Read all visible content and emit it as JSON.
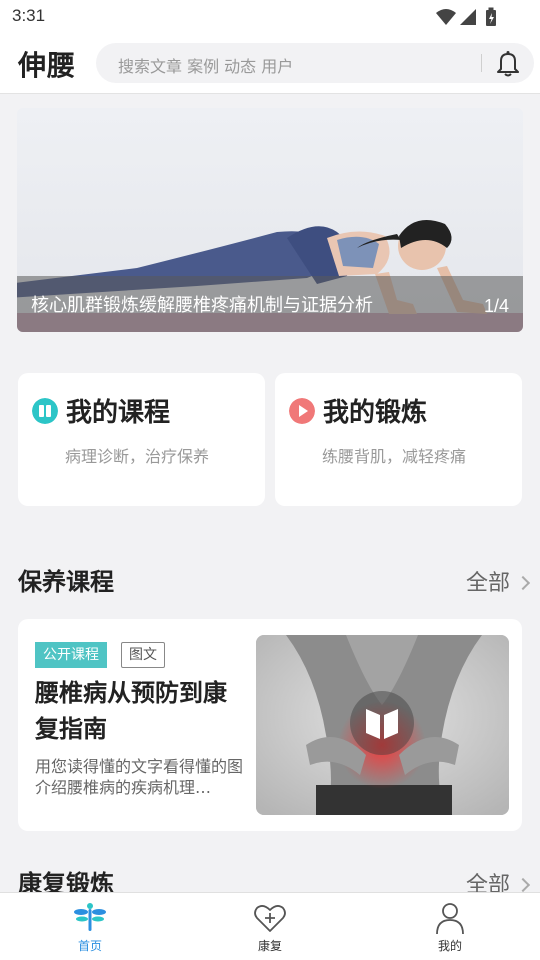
{
  "status_bar": {
    "time": "3:31"
  },
  "header": {
    "app_title": "伸腰",
    "search_placeholder": "搜索文章 案例 动态 用户"
  },
  "banner": {
    "caption": "核心肌群锻炼缓解腰椎疼痛机制与证据分析",
    "counter": "1/4"
  },
  "quick_cards": [
    {
      "title": "我的课程",
      "subtitle": "病理诊断，治疗保养",
      "icon": "book-icon",
      "color": "#2cc5c7"
    },
    {
      "title": "我的锻炼",
      "subtitle": "练腰背肌，减轻疼痛",
      "icon": "play-icon",
      "color": "#f07878"
    }
  ],
  "sections": {
    "care": {
      "title": "保养课程",
      "more": "全部"
    },
    "rehab": {
      "title": "康复锻炼",
      "more": "全部"
    }
  },
  "course": {
    "tag_public": "公开课程",
    "tag_type": "图文",
    "title": "腰椎病从预防到康复指南",
    "description": "用您读得懂的文字看得懂的图介绍腰椎病的疾病机理…"
  },
  "bottom_nav": [
    {
      "label": "首页",
      "icon": "dragonfly-icon",
      "active": true
    },
    {
      "label": "康复",
      "icon": "heart-plus-icon",
      "active": false
    },
    {
      "label": "我的",
      "icon": "user-icon",
      "active": false
    }
  ],
  "colors": {
    "accent": "#2cc5c7",
    "active_nav": "#2b8fe0",
    "exercise_icon": "#f07878"
  }
}
